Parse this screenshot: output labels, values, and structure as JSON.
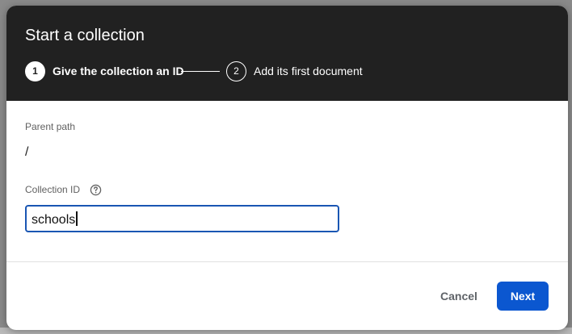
{
  "dialog": {
    "title": "Start a collection",
    "steps": [
      {
        "number": "1",
        "label": "Give the collection an ID",
        "active": true
      },
      {
        "number": "2",
        "label": "Add its first document",
        "active": false
      }
    ]
  },
  "parent_path": {
    "label": "Parent path",
    "value": "/"
  },
  "collection_id": {
    "label": "Collection ID",
    "help_icon": "help-circle-icon",
    "value": "schools",
    "focused": true
  },
  "actions": {
    "cancel_label": "Cancel",
    "next_label": "Next"
  },
  "colors": {
    "header_bg": "#212121",
    "accent": "#0b57d0",
    "input_border": "#1a56b3"
  }
}
